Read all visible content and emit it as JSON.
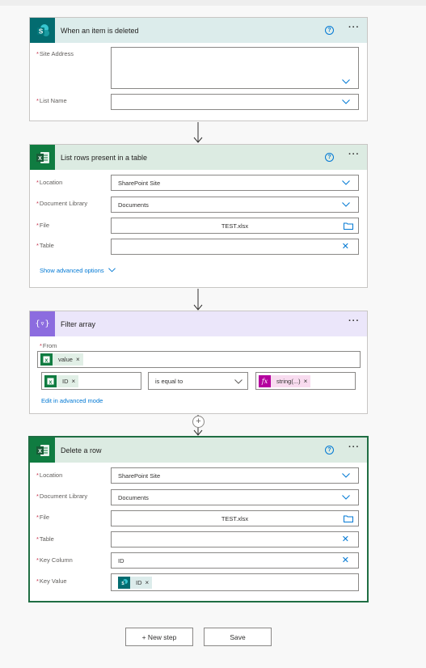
{
  "trigger": {
    "title": "When an item is deleted",
    "help": "?",
    "more": "···",
    "fields": {
      "site_address": {
        "label": "Site Address",
        "value": ""
      },
      "list_name": {
        "label": "List Name",
        "value": ""
      }
    }
  },
  "list_rows": {
    "title": "List rows present in a table",
    "help": "?",
    "more": "···",
    "fields": {
      "location": {
        "label": "Location",
        "value": "SharePoint Site"
      },
      "document_library": {
        "label": "Document Library",
        "value": "Documents"
      },
      "file": {
        "label": "File",
        "value": "TEST.xlsx"
      },
      "table": {
        "label": "Table",
        "value": ""
      }
    },
    "advanced_link": "Show advanced options"
  },
  "filter": {
    "title": "Filter array",
    "more": "···",
    "from_label": "From",
    "from_token": "value",
    "left_token": "ID",
    "operator": "is equal to",
    "right_token": "string(...)",
    "edit_link": "Edit in advanced mode"
  },
  "delete_row": {
    "title": "Delete a row",
    "help": "?",
    "more": "···",
    "fields": {
      "location": {
        "label": "Location",
        "value": "SharePoint Site"
      },
      "document_library": {
        "label": "Document Library",
        "value": "Documents"
      },
      "file": {
        "label": "File",
        "value": "TEST.xlsx"
      },
      "table": {
        "label": "Table",
        "value": ""
      },
      "key_column": {
        "label": "Key Column",
        "value": "ID"
      },
      "key_value": {
        "label": "Key Value",
        "token": "ID"
      }
    }
  },
  "footer": {
    "new_step": "+ New step",
    "save": "Save"
  },
  "glyphs": {
    "required": "*",
    "remove": "×",
    "clear": "✕",
    "plus": "+",
    "filter_icon": "{▿}",
    "fx": "fx"
  },
  "icons": {
    "sharepoint": "sharepoint-icon",
    "excel": "excel-icon",
    "filter": "filter-icon",
    "expression": "fx-icon"
  },
  "colors": {
    "sharepoint": "#036c70",
    "excel": "#107c41",
    "filter": "#8c6cdf",
    "expression": "#b4009e",
    "accent": "#0078d4",
    "required": "#c4314b"
  }
}
